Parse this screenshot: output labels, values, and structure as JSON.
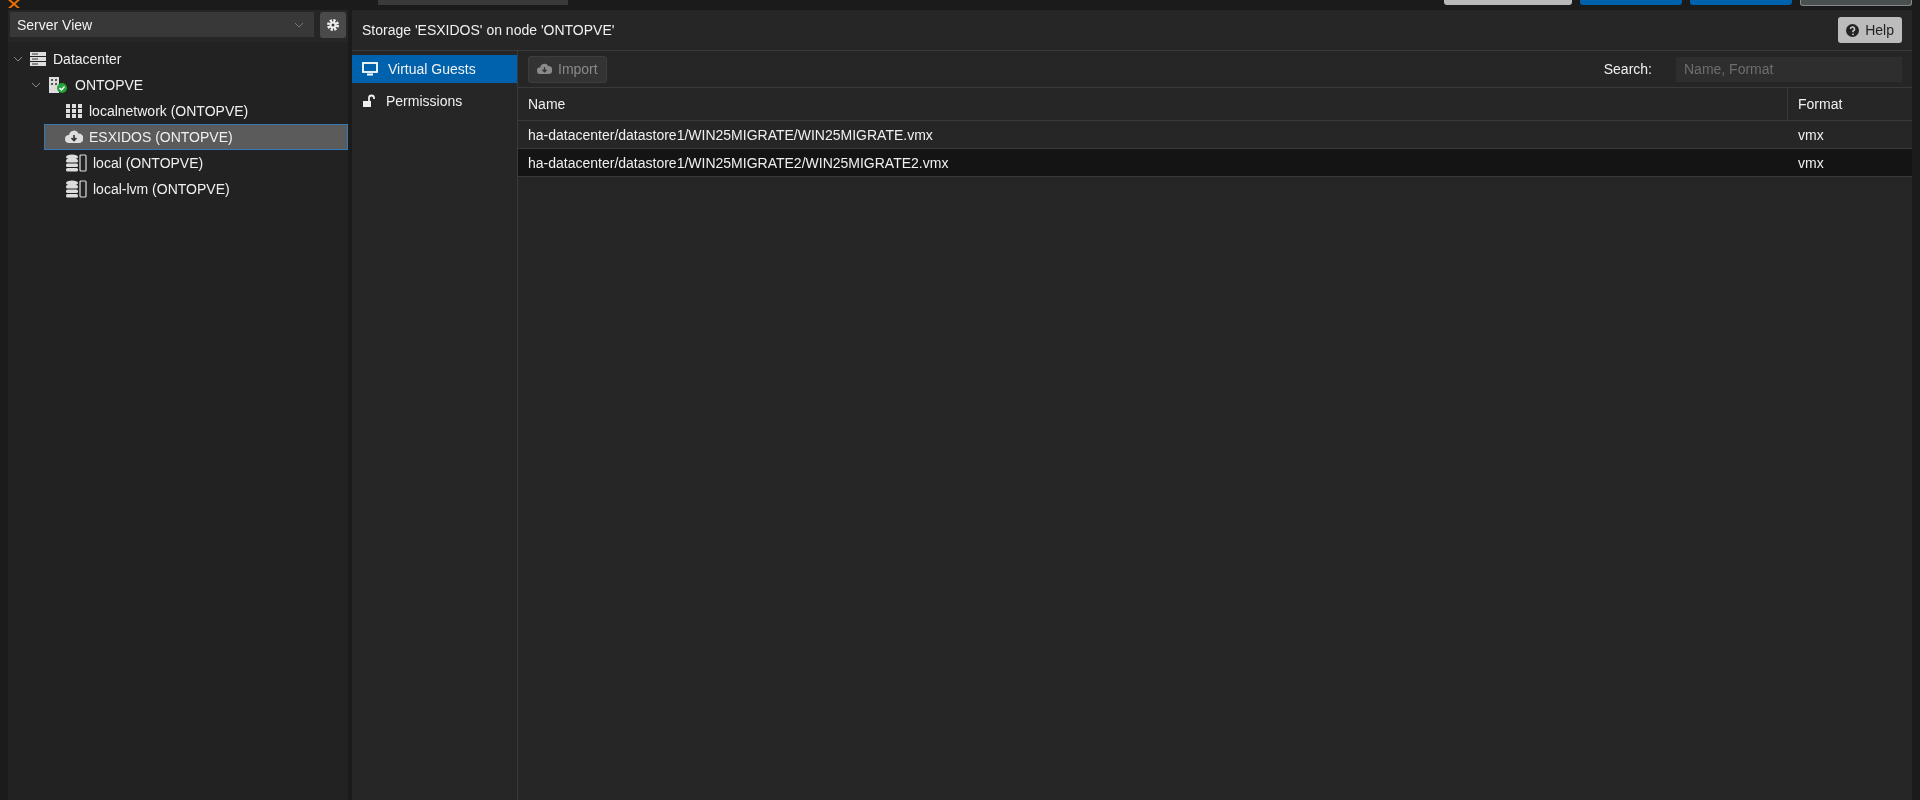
{
  "view_selector": {
    "value": "Server View"
  },
  "tree": [
    {
      "label": "Datacenter",
      "kind": "datacenter",
      "expanded": true,
      "selected": false,
      "children": [
        {
          "label": "ONTOPVE",
          "kind": "node",
          "expanded": true,
          "selected": false,
          "children": [
            {
              "label": "localnetwork (ONTOPVE)",
              "kind": "zone",
              "selected": false
            },
            {
              "label": "ESXIDOS (ONTOPVE)",
              "kind": "cloud",
              "selected": true
            },
            {
              "label": "local (ONTOPVE)",
              "kind": "storage",
              "selected": false
            },
            {
              "label": "local-lvm (ONTOPVE)",
              "kind": "storage",
              "selected": false
            }
          ]
        }
      ]
    }
  ],
  "panel": {
    "title": "Storage 'ESXIDOS' on node 'ONTOPVE'",
    "help_button": "Help"
  },
  "tabs": [
    {
      "label": "Virtual Guests",
      "kind": "monitor",
      "selected": true
    },
    {
      "label": "Permissions",
      "kind": "lock",
      "selected": false
    }
  ],
  "toolbar": {
    "import_button": "Import",
    "import_disabled": true,
    "search_label": "Search:",
    "search_placeholder": "Name, Format"
  },
  "table": {
    "columns": [
      "Name",
      "Format"
    ],
    "rows": [
      {
        "cells": [
          "ha-datacenter/datastore1/WIN25MIGRATE/WIN25MIGRATE.vmx",
          "vmx"
        ],
        "selected": false
      },
      {
        "cells": [
          "ha-datacenter/datastore1/WIN25MIGRATE2/WIN25MIGRATE2.vmx",
          "vmx"
        ],
        "selected": true
      }
    ]
  }
}
